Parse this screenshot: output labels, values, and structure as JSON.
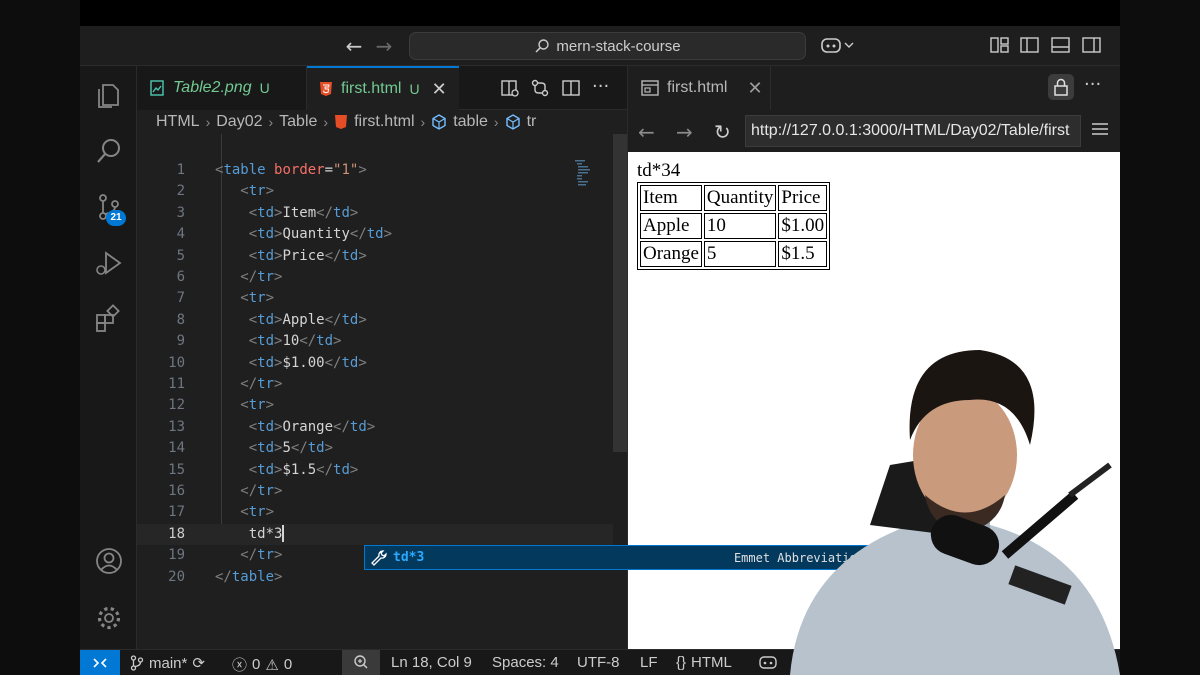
{
  "window": {
    "search_text": "mern-stack-course"
  },
  "activity_bar": {
    "source_control_badge": "21"
  },
  "editor": {
    "tabs": [
      {
        "label": "Table2.png",
        "status": "U",
        "active": false
      },
      {
        "label": "first.html",
        "status": "U",
        "active": true
      }
    ],
    "breadcrumb": [
      "HTML",
      "Day02",
      "Table",
      "first.html",
      "table",
      "tr"
    ],
    "lines": [
      {
        "n": "1",
        "segments": [
          [
            "br",
            "<"
          ],
          [
            "tag",
            "table"
          ],
          [
            "sp",
            " "
          ],
          [
            "attr",
            "border"
          ],
          [
            "eq",
            "="
          ],
          [
            "val",
            "\"1\""
          ],
          [
            "br",
            ">"
          ]
        ]
      },
      {
        "n": "2",
        "segments": [
          [
            "sp",
            "   "
          ],
          [
            "br",
            "<"
          ],
          [
            "tag",
            "tr"
          ],
          [
            "br",
            ">"
          ]
        ]
      },
      {
        "n": "3",
        "segments": [
          [
            "sp",
            "    "
          ],
          [
            "br",
            "<"
          ],
          [
            "tag",
            "td"
          ],
          [
            "br",
            ">"
          ],
          [
            "txt",
            "Item"
          ],
          [
            "br",
            "</"
          ],
          [
            "tag",
            "td"
          ],
          [
            "br",
            ">"
          ]
        ]
      },
      {
        "n": "4",
        "segments": [
          [
            "sp",
            "    "
          ],
          [
            "br",
            "<"
          ],
          [
            "tag",
            "td"
          ],
          [
            "br",
            ">"
          ],
          [
            "txt",
            "Quantity"
          ],
          [
            "br",
            "</"
          ],
          [
            "tag",
            "td"
          ],
          [
            "br",
            ">"
          ]
        ]
      },
      {
        "n": "5",
        "segments": [
          [
            "sp",
            "    "
          ],
          [
            "br",
            "<"
          ],
          [
            "tag",
            "td"
          ],
          [
            "br",
            ">"
          ],
          [
            "txt",
            "Price"
          ],
          [
            "br",
            "</"
          ],
          [
            "tag",
            "td"
          ],
          [
            "br",
            ">"
          ]
        ]
      },
      {
        "n": "6",
        "segments": [
          [
            "sp",
            "   "
          ],
          [
            "br",
            "</"
          ],
          [
            "tag",
            "tr"
          ],
          [
            "br",
            ">"
          ]
        ]
      },
      {
        "n": "7",
        "segments": [
          [
            "sp",
            "   "
          ],
          [
            "br",
            "<"
          ],
          [
            "tag",
            "tr"
          ],
          [
            "br",
            ">"
          ]
        ]
      },
      {
        "n": "8",
        "segments": [
          [
            "sp",
            "    "
          ],
          [
            "br",
            "<"
          ],
          [
            "tag",
            "td"
          ],
          [
            "br",
            ">"
          ],
          [
            "txt",
            "Apple"
          ],
          [
            "br",
            "</"
          ],
          [
            "tag",
            "td"
          ],
          [
            "br",
            ">"
          ]
        ]
      },
      {
        "n": "9",
        "segments": [
          [
            "sp",
            "    "
          ],
          [
            "br",
            "<"
          ],
          [
            "tag",
            "td"
          ],
          [
            "br",
            ">"
          ],
          [
            "txt",
            "10"
          ],
          [
            "br",
            "</"
          ],
          [
            "tag",
            "td"
          ],
          [
            "br",
            ">"
          ]
        ]
      },
      {
        "n": "10",
        "segments": [
          [
            "sp",
            "    "
          ],
          [
            "br",
            "<"
          ],
          [
            "tag",
            "td"
          ],
          [
            "br",
            ">"
          ],
          [
            "txt",
            "$1.00"
          ],
          [
            "br",
            "</"
          ],
          [
            "tag",
            "td"
          ],
          [
            "br",
            ">"
          ]
        ]
      },
      {
        "n": "11",
        "segments": [
          [
            "sp",
            "   "
          ],
          [
            "br",
            "</"
          ],
          [
            "tag",
            "tr"
          ],
          [
            "br",
            ">"
          ]
        ]
      },
      {
        "n": "12",
        "segments": [
          [
            "sp",
            "   "
          ],
          [
            "br",
            "<"
          ],
          [
            "tag",
            "tr"
          ],
          [
            "br",
            ">"
          ]
        ]
      },
      {
        "n": "13",
        "segments": [
          [
            "sp",
            "    "
          ],
          [
            "br",
            "<"
          ],
          [
            "tag",
            "td"
          ],
          [
            "br",
            ">"
          ],
          [
            "txt",
            "Orange"
          ],
          [
            "br",
            "</"
          ],
          [
            "tag",
            "td"
          ],
          [
            "br",
            ">"
          ]
        ]
      },
      {
        "n": "14",
        "segments": [
          [
            "sp",
            "    "
          ],
          [
            "br",
            "<"
          ],
          [
            "tag",
            "td"
          ],
          [
            "br",
            ">"
          ],
          [
            "txt",
            "5"
          ],
          [
            "br",
            "</"
          ],
          [
            "tag",
            "td"
          ],
          [
            "br",
            ">"
          ]
        ]
      },
      {
        "n": "15",
        "segments": [
          [
            "sp",
            "    "
          ],
          [
            "br",
            "<"
          ],
          [
            "tag",
            "td"
          ],
          [
            "br",
            ">"
          ],
          [
            "txt",
            "$1.5"
          ],
          [
            "br",
            "</"
          ],
          [
            "tag",
            "td"
          ],
          [
            "br",
            ">"
          ]
        ]
      },
      {
        "n": "16",
        "segments": [
          [
            "sp",
            "   "
          ],
          [
            "br",
            "</"
          ],
          [
            "tag",
            "tr"
          ],
          [
            "br",
            ">"
          ]
        ]
      },
      {
        "n": "17",
        "segments": [
          [
            "sp",
            "   "
          ],
          [
            "br",
            "<"
          ],
          [
            "tag",
            "tr"
          ],
          [
            "br",
            ">"
          ]
        ]
      },
      {
        "n": "18",
        "segments": [
          [
            "sp",
            "    "
          ],
          [
            "txt",
            "td*3"
          ]
        ],
        "current": true
      },
      {
        "n": "19",
        "segments": [
          [
            "sp",
            "   "
          ],
          [
            "br",
            "</"
          ],
          [
            "tag",
            "tr"
          ],
          [
            "br",
            ">"
          ]
        ]
      },
      {
        "n": "20",
        "segments": [
          [
            "br",
            "</"
          ],
          [
            "tag",
            "table"
          ],
          [
            "br",
            ">"
          ]
        ]
      }
    ],
    "suggestion": {
      "label": "td*3",
      "kind": "Emmet Abbreviation"
    }
  },
  "browser": {
    "tab_label": "first.html",
    "url": "http://127.0.0.1:3000/HTML/Day02/Table/first",
    "page_text": "td*34",
    "table": [
      [
        "Item",
        "Quantity",
        "Price"
      ],
      [
        "Apple",
        "10",
        "$1.00"
      ],
      [
        "Orange",
        "5",
        "$1.5"
      ]
    ]
  },
  "status_bar": {
    "branch": "main*",
    "errors": "0",
    "warnings": "0",
    "position": "Ln 18, Col 9",
    "spaces": "Spaces: 4",
    "encoding": "UTF-8",
    "eol": "LF",
    "language": "HTML"
  },
  "colors": {
    "accent": "#0078d4",
    "tag": "#569cd6",
    "attribute": "#f47067",
    "string": "#ce9178",
    "untracked": "#73c991"
  }
}
